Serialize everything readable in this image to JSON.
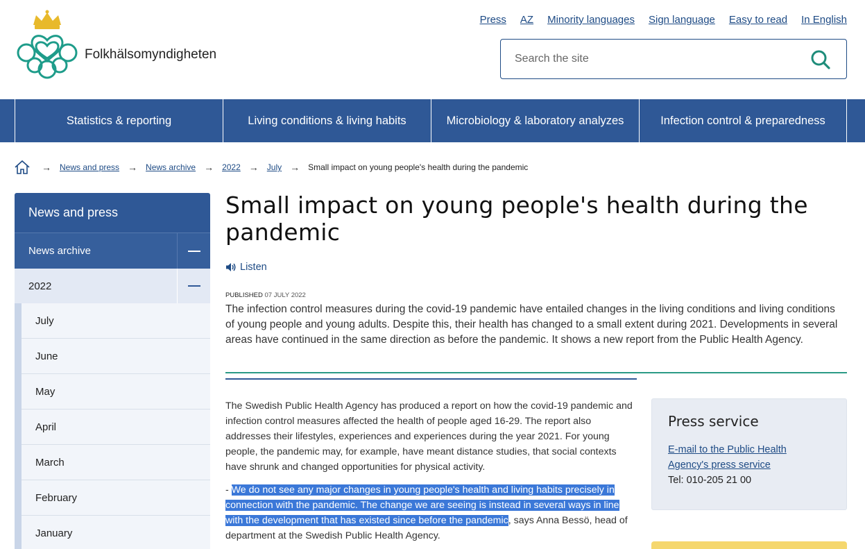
{
  "header": {
    "site_name": "Folkhälsomyndigheten",
    "top_links": [
      "Press",
      "AZ",
      "Minority languages",
      "Sign language",
      "Easy to read",
      "In English"
    ],
    "search_placeholder": "Search the site"
  },
  "nav": {
    "items": [
      "Statistics & reporting",
      "Living conditions & living habits",
      "Microbiology & laboratory analyzes",
      "Infection control & preparedness"
    ]
  },
  "breadcrumb": {
    "links": [
      "News and press",
      "News archive",
      "2022",
      "July"
    ],
    "current": "Small impact on young people's health during the pandemic"
  },
  "sidebar": {
    "title": "News and press",
    "section": "News archive",
    "year": "2022",
    "months": [
      "July",
      "June",
      "May",
      "April",
      "March",
      "February",
      "January"
    ]
  },
  "article": {
    "title": "Small impact on young people's health during the pandemic",
    "listen_label": "Listen",
    "published_label": "PUBLISHED",
    "published_date": "07 JULY 2022",
    "ingress": "The infection control measures during the covid-19 pandemic have entailed changes in the living conditions and living conditions of young people and young adults. Despite this, their health has changed to a small extent during 2021. Developments in several areas have continued in the same direction as before the pandemic. It shows a new report from the Public Health Agency.",
    "para1": "The Swedish Public Health Agency has produced a report on how the covid-19 pandemic and infection control measures affected the health of people aged 16-29. The report also addresses their lifestyles, experiences and experiences during the year 2021. For young people, the pandemic may, for example, have meant distance studies, that social contexts have shrunk and changed opportunities for physical activity.",
    "para2_prefix": "- ",
    "para2_highlight": "We do not see any major changes in young people's health and living habits precisely in connection with the pandemic. The change we are seeing is instead in several ways in line with the development that has existed since before the pandemic",
    "para2_suffix": ", says Anna Bessö, head of department at the Swedish Public Health Agency."
  },
  "press_box": {
    "title": "Press service",
    "link": "E-mail to the Public Health Agency's press service",
    "tel": "Tel: 010-205 21 00"
  },
  "colors": {
    "brand_blue": "#2f5896",
    "link_blue": "#1e4b85",
    "teal": "#2b9a86",
    "crown_gold": "#e8b92b"
  }
}
